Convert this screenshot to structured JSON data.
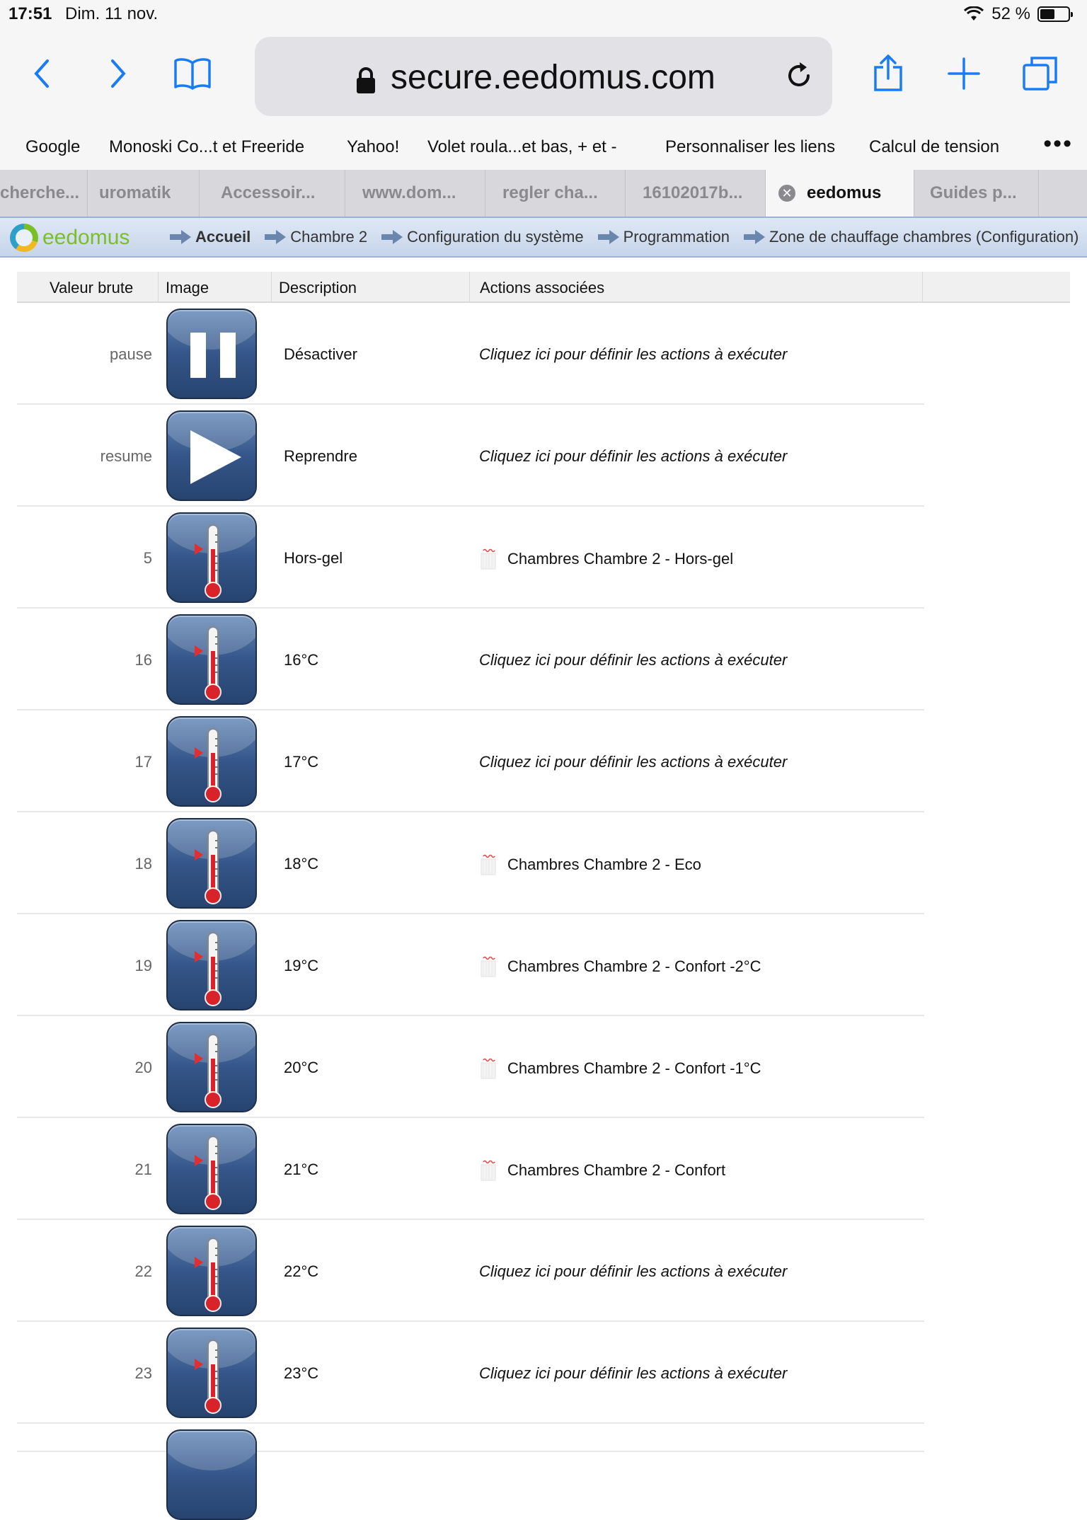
{
  "status": {
    "time": "17:51",
    "date": "Dim. 11 nov.",
    "battery": "52 %",
    "battery_level": 0.52
  },
  "browser": {
    "url": "secure.eedomus.com",
    "bookmarks": [
      "Google",
      "Monoski Co...t et Freeride",
      "Yahoo!",
      "Volet roula...et bas, + et -",
      "Personnaliser les liens",
      "Calcul de tension"
    ],
    "bookmarks_more": "•••",
    "tabs": [
      {
        "label": "cherche...",
        "active": false
      },
      {
        "label": "uromatik",
        "active": false
      },
      {
        "label": "Accessoir...",
        "active": false
      },
      {
        "label": "www.dom...",
        "active": false
      },
      {
        "label": "regler cha...",
        "active": false
      },
      {
        "label": "16102017b...",
        "active": false
      },
      {
        "label": "eedomus",
        "active": true
      },
      {
        "label": "Guides p...",
        "active": false
      }
    ],
    "tab_close_glyph": "✕"
  },
  "app": {
    "logo": "eedomus",
    "breadcrumb": [
      "Accueil",
      "Chambre 2",
      "Configuration du système",
      "Programmation",
      "Zone de chauffage chambres (Configuration)"
    ]
  },
  "table": {
    "headers": [
      "Valeur brute",
      "Image",
      "Description",
      "Actions associées"
    ],
    "define_text": "Cliquez ici pour définir les actions à exécuter",
    "rows": [
      {
        "value": "pause",
        "icon": "pause-icon",
        "description": "Désactiver",
        "action": ""
      },
      {
        "value": "resume",
        "icon": "play-icon",
        "description": "Reprendre",
        "action": ""
      },
      {
        "value": "5",
        "icon": "thermometer-icon",
        "description": "Hors-gel",
        "action": "Chambres Chambre 2 - Hors-gel"
      },
      {
        "value": "16",
        "icon": "thermometer-icon",
        "description": "16°C",
        "action": ""
      },
      {
        "value": "17",
        "icon": "thermometer-icon",
        "description": "17°C",
        "action": ""
      },
      {
        "value": "18",
        "icon": "thermometer-icon",
        "description": "18°C",
        "action": "Chambres Chambre 2 - Eco"
      },
      {
        "value": "19",
        "icon": "thermometer-icon",
        "description": "19°C",
        "action": "Chambres Chambre 2 - Confort -2°C"
      },
      {
        "value": "20",
        "icon": "thermometer-icon",
        "description": "20°C",
        "action": "Chambres Chambre 2 - Confort -1°C"
      },
      {
        "value": "21",
        "icon": "thermometer-icon",
        "description": "21°C",
        "action": "Chambres Chambre 2 - Confort"
      },
      {
        "value": "22",
        "icon": "thermometer-icon",
        "description": "22°C",
        "action": ""
      },
      {
        "value": "23",
        "icon": "thermometer-icon",
        "description": "23°C",
        "action": ""
      }
    ]
  },
  "colors": {
    "ios_blue": "#1a7cf5",
    "tile_blue": "#35568a",
    "eedomus_green": "#7bbf28"
  }
}
